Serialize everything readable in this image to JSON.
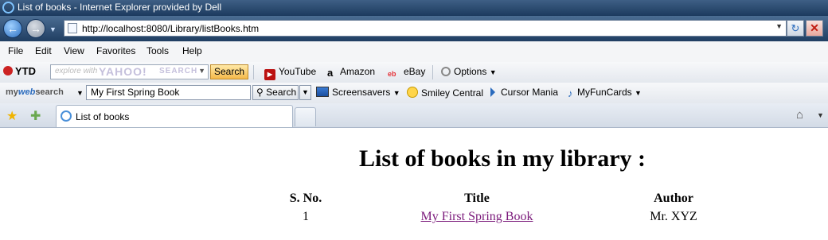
{
  "window": {
    "title": "List of books - Internet Explorer provided by Dell",
    "url": "http://localhost:8080/Library/listBooks.htm"
  },
  "menu": [
    "File",
    "Edit",
    "View",
    "Favorites",
    "Tools",
    "Help"
  ],
  "toolbar1": {
    "ytd_label": "YTD",
    "yahoo_placeholder": "explore with",
    "yahoo_logo": "YAHOO!",
    "yahoo_search_word": "SEARCH",
    "search_button": "Search",
    "links": [
      "YouTube",
      "Amazon",
      "eBay"
    ],
    "options_label": "Options"
  },
  "toolbar2": {
    "brand_prefix": "my",
    "brand_mid": "web",
    "brand_suffix": "search",
    "search_value": "My First Spring Book",
    "search_button": "Search",
    "links": [
      "Screensavers",
      "Smiley Central",
      "Cursor Mania",
      "MyFunCards"
    ]
  },
  "tabs": [
    {
      "label": "List of books"
    }
  ],
  "page": {
    "heading": "List of books in my library :",
    "columns": [
      "S. No.",
      "Title",
      "Author"
    ],
    "rows": [
      {
        "sno": "1",
        "title": "My First Spring Book",
        "author": "Mr. XYZ"
      }
    ]
  }
}
